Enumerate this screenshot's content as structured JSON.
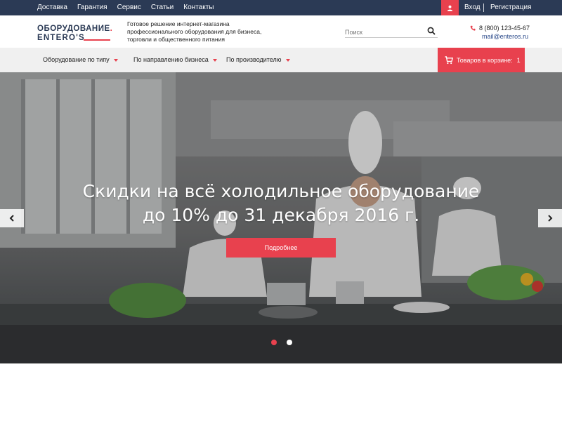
{
  "topbar": {
    "nav": [
      "Доставка",
      "Гарантия",
      "Сервис",
      "Статьи",
      "Контакты"
    ],
    "login": "Вход",
    "register": "Регистрация"
  },
  "header": {
    "logo_line1": "ОБОРУДОВАНИЕ",
    "logo_line2": "ENTERO'S",
    "tagline": "Готовое решение интернет-магазина профессионального оборудования для бизнеса, торговли и общественного питания",
    "search_placeholder": "Поиск",
    "phone": "8 (800) 123-45-67",
    "email": "mail@enteros.ru"
  },
  "catbar": {
    "items": [
      "Оборудование по типу",
      "По направлению бизнеса",
      "По производителю"
    ],
    "cart_label": "Товаров в корзине:",
    "cart_count": "1"
  },
  "hero": {
    "title_line1": "Скидки на всё холодильное оборудование",
    "title_line2": "до 10% до 31 декабря 2016 г.",
    "button": "Подробнее",
    "slides": 2,
    "active_slide": 1
  },
  "colors": {
    "accent": "#e8414e",
    "navy": "#2b3a55",
    "catbar_bg": "#f0f0f0"
  }
}
